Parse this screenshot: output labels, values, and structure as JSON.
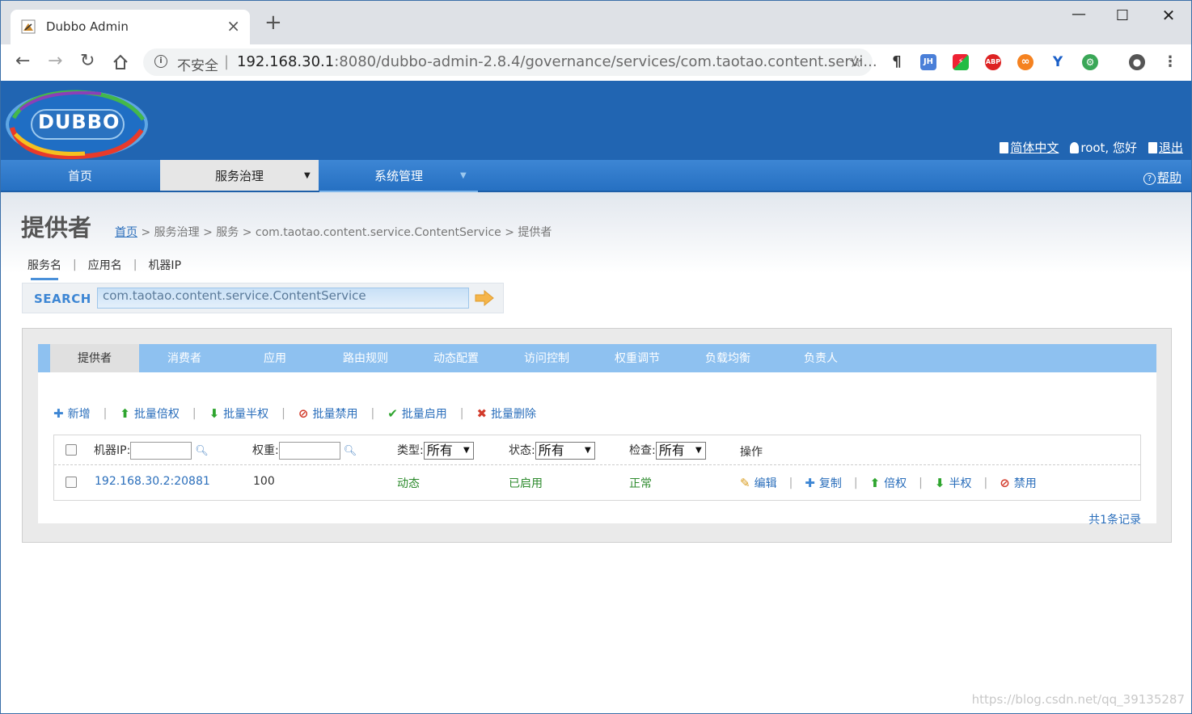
{
  "browser": {
    "tab_title": "Dubbo Admin",
    "new_tab": "+",
    "insecure_label": "不安全",
    "url_host": "192.168.30.1",
    "url_rest": ":8080/dubbo-admin-2.8.4/governance/services/com.taotao.content.servi...",
    "extensions": [
      "JH",
      "ABP"
    ]
  },
  "header": {
    "logo_text": "DUBBO",
    "lang_link": "简体中文",
    "user_greeting": "root, 您好",
    "logout_link": "退出"
  },
  "nav": {
    "items": [
      "首页",
      "服务治理",
      "系统管理"
    ],
    "help": "帮助"
  },
  "page": {
    "title": "提供者",
    "breadcrumb": {
      "home": "首页",
      "trail": " > 服务治理 > 服务 > com.taotao.content.service.ContentService > 提供者"
    }
  },
  "search": {
    "tabs": [
      "服务名",
      "应用名",
      "机器IP"
    ],
    "label": "SEARCH",
    "value": "com.taotao.content.service.ContentService"
  },
  "subtabs": [
    "提供者",
    "消费者",
    "应用",
    "路由规则",
    "动态配置",
    "访问控制",
    "权重调节",
    "负载均衡",
    "负责人"
  ],
  "actions": [
    "新增",
    "批量倍权",
    "批量半权",
    "批量禁用",
    "批量启用",
    "批量删除"
  ],
  "table": {
    "header": {
      "ip_label": "机器IP:",
      "weight_label": "权重:",
      "type_label": "类型:",
      "type_value": "所有",
      "status_label": "状态:",
      "status_value": "所有",
      "check_label": "检查:",
      "check_value": "所有",
      "ops_label": "操作"
    },
    "rows": [
      {
        "address": "192.168.30.2:20881",
        "weight": "100",
        "type": "动态",
        "status": "已启用",
        "check": "正常",
        "ops": [
          "编辑",
          "复制",
          "倍权",
          "半权",
          "禁用"
        ]
      }
    ]
  },
  "total": "共1条记录",
  "watermark": "https://blog.csdn.net/qq_39135287"
}
